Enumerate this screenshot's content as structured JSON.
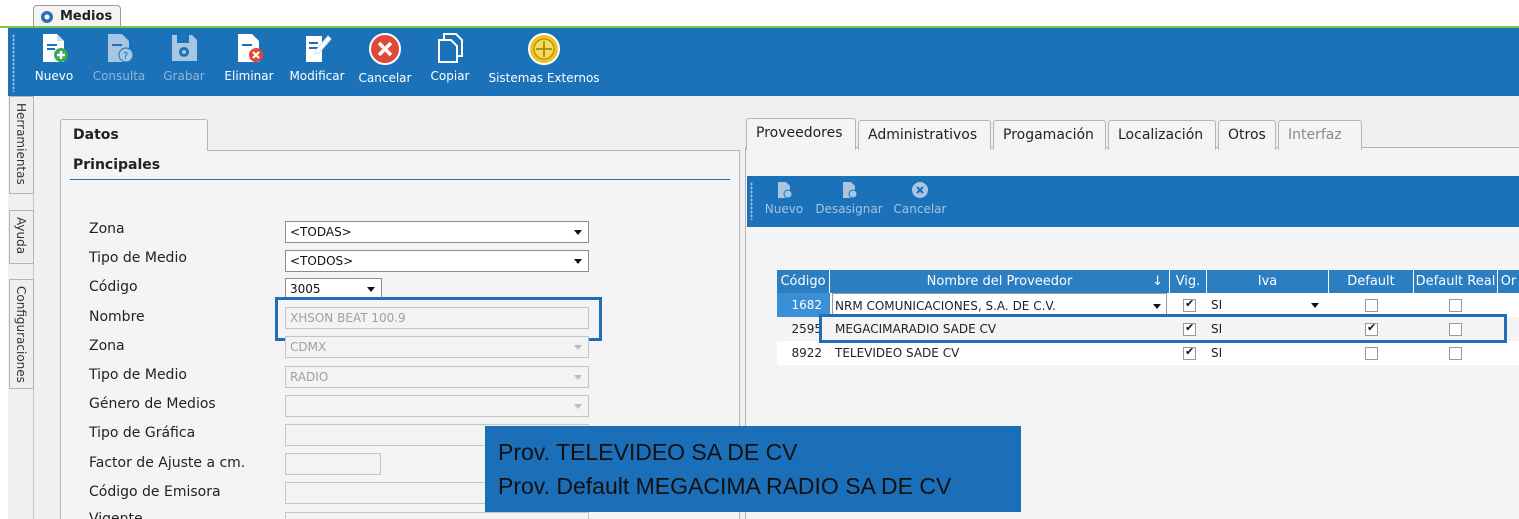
{
  "window": {
    "tab_title": "Medios"
  },
  "toolbar": {
    "buttons": [
      {
        "label": "Nuevo",
        "icon": "new-document-icon",
        "enabled": true
      },
      {
        "label": "Consulta",
        "icon": "query-document-icon",
        "enabled": false
      },
      {
        "label": "Grabar",
        "icon": "save-icon",
        "enabled": false
      },
      {
        "label": "Eliminar",
        "icon": "delete-document-icon",
        "enabled": true
      },
      {
        "label": "Modificar",
        "icon": "edit-icon",
        "enabled": true
      },
      {
        "label": "Cancelar",
        "icon": "cancel-icon",
        "enabled": true
      },
      {
        "label": "Copiar",
        "icon": "copy-icon",
        "enabled": true
      },
      {
        "label": "Sistemas Externos",
        "icon": "external-systems-icon",
        "enabled": true
      }
    ]
  },
  "side_tabs": [
    "Herramientas",
    "Ayuda",
    "Configuraciones"
  ],
  "left_panel": {
    "tab": "Datos Principales",
    "fields": [
      {
        "label": "Zona",
        "value": "<TODAS>",
        "type": "select",
        "enabled": true
      },
      {
        "label": "Tipo de Medio",
        "value": "<TODOS>",
        "type": "select",
        "enabled": true
      },
      {
        "label": "Código",
        "value": "3005",
        "type": "select",
        "enabled": true
      },
      {
        "label": "Nombre",
        "value": "XHSON BEAT 100.9",
        "type": "text",
        "enabled": false
      },
      {
        "label": "Zona",
        "value": "CDMX",
        "type": "select",
        "enabled": false
      },
      {
        "label": "Tipo de Medio",
        "value": "RADIO",
        "type": "select",
        "enabled": false
      },
      {
        "label": "Género de Medios",
        "value": "",
        "type": "select",
        "enabled": false
      },
      {
        "label": "Tipo de Gráfica",
        "value": "",
        "type": "text",
        "enabled": false
      },
      {
        "label": "Factor de Ajuste a cm.",
        "value": "",
        "type": "text",
        "enabled": false
      },
      {
        "label": "Código de Emisora",
        "value": "",
        "type": "text",
        "enabled": false
      },
      {
        "label": "Vigente",
        "value": "",
        "type": "text",
        "enabled": false
      }
    ]
  },
  "right_panel": {
    "tabs": [
      {
        "label": "Proveedores",
        "active": true,
        "enabled": true
      },
      {
        "label": "Administrativos",
        "active": false,
        "enabled": true
      },
      {
        "label": "Progamación",
        "active": false,
        "enabled": true
      },
      {
        "label": "Localización",
        "active": false,
        "enabled": true
      },
      {
        "label": "Otros",
        "active": false,
        "enabled": true
      },
      {
        "label": "Interfaz",
        "active": false,
        "enabled": false
      }
    ],
    "sub_toolbar": [
      "Nuevo",
      "Desasignar",
      "Cancelar"
    ],
    "grid": {
      "columns": [
        "Código",
        "Nombre del Proveedor",
        "Vig.",
        "Iva",
        "Default",
        "Default Real",
        "Or"
      ],
      "sort_glyph": "↓",
      "rows": [
        {
          "codigo": "1682",
          "nombre": "NRM COMUNICACIONES, S.A. DE C.V.",
          "vig": true,
          "iva": "SI",
          "default": false,
          "default_real": false,
          "editing": true
        },
        {
          "codigo": "2595",
          "nombre": "MEGACIMARADIO SADE CV",
          "vig": true,
          "iva": "SI",
          "default": true,
          "default_real": false,
          "editing": false
        },
        {
          "codigo": "8922",
          "nombre": "TELEVIDEO SADE CV",
          "vig": true,
          "iva": "SI",
          "default": false,
          "default_real": false,
          "editing": false
        }
      ]
    }
  },
  "callout": {
    "line1": "Prov. TELEVIDEO SA DE CV",
    "line2": "Prov. Default MEGACIMA RADIO SA DE CV"
  },
  "colors": {
    "toolbar_blue": "#1b72b8",
    "grid_header": "#2b7ec1",
    "highlight": "#1f6fb6",
    "accent_green": "#7fc24a"
  }
}
